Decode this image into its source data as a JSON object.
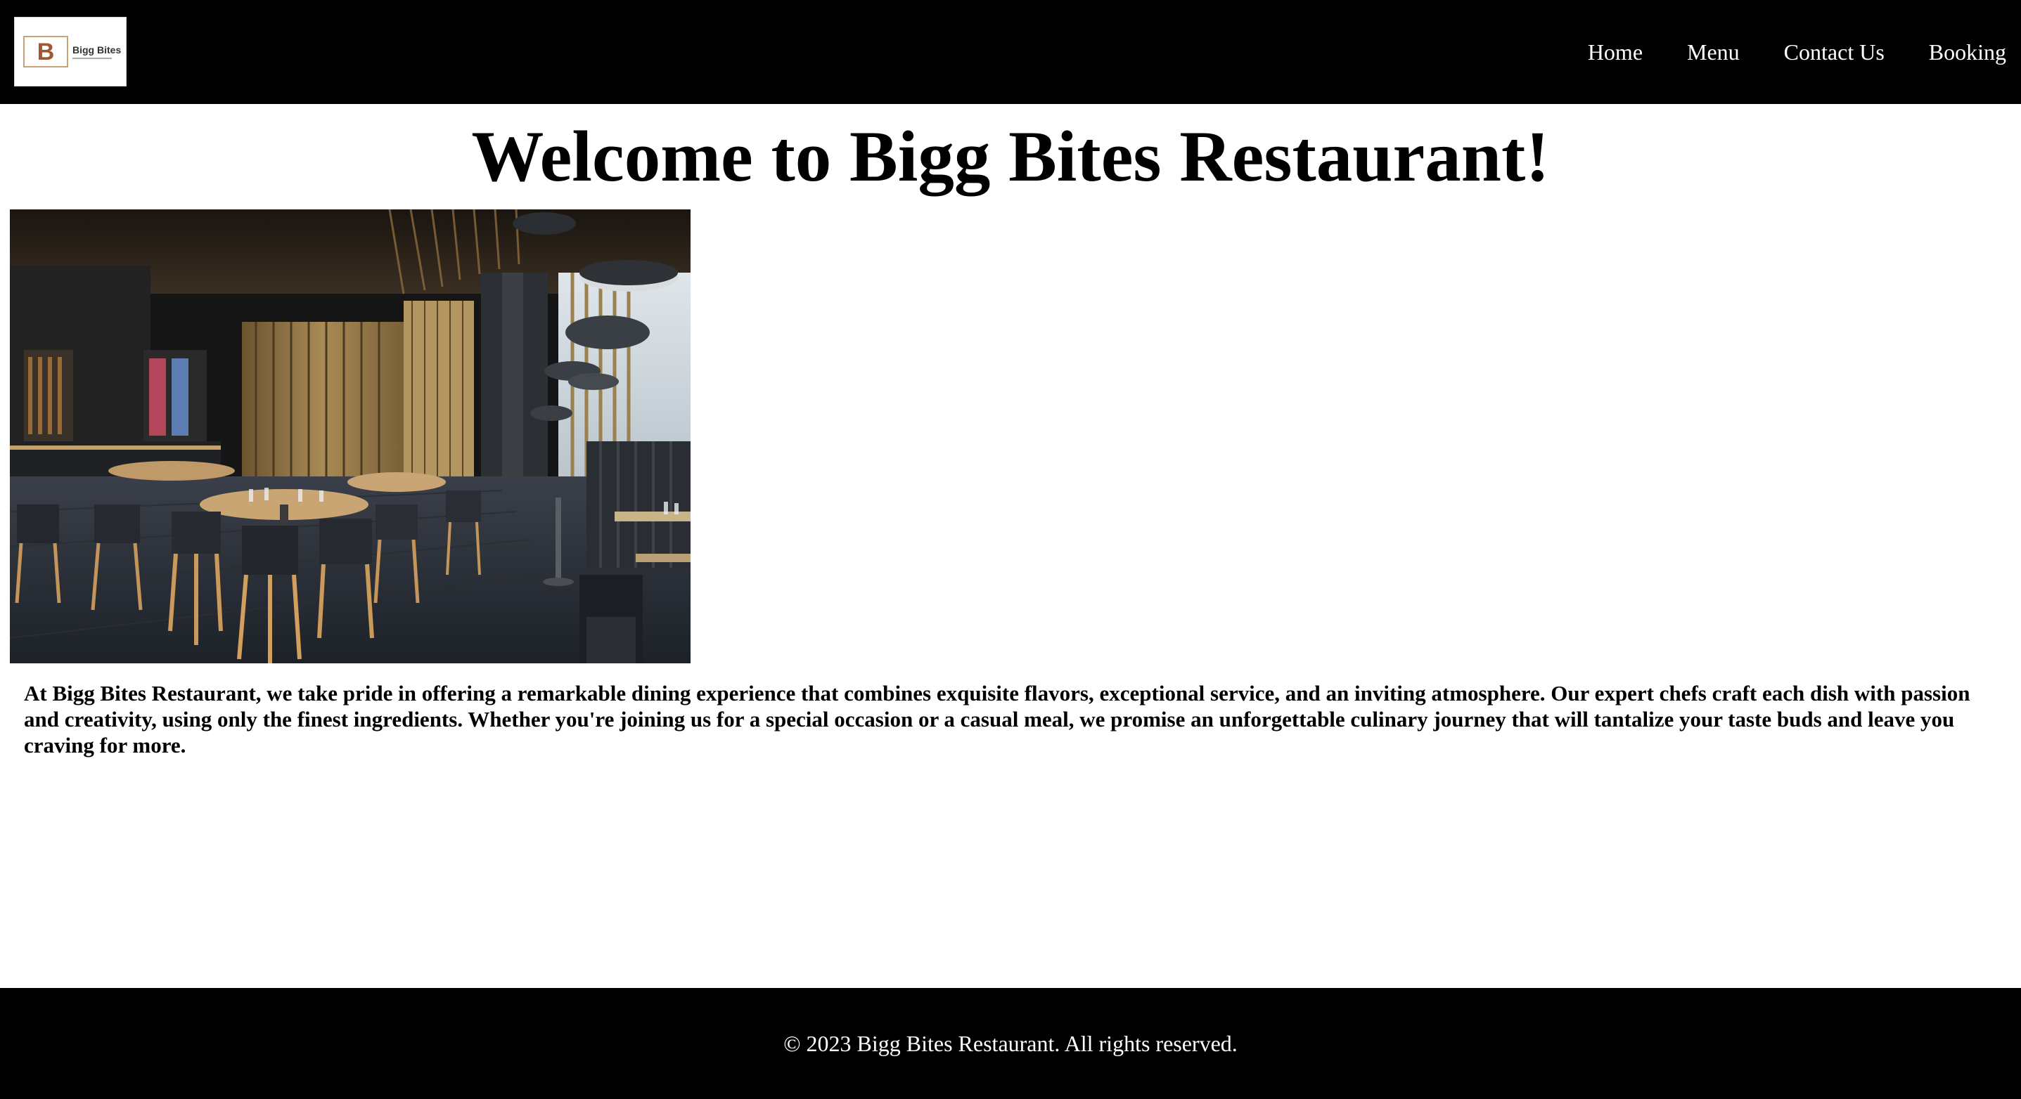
{
  "header": {
    "logo": {
      "letter": "B",
      "name": "Bigg Bites"
    },
    "nav": [
      {
        "label": "Home"
      },
      {
        "label": "Menu"
      },
      {
        "label": "Contact Us"
      },
      {
        "label": "Booking"
      }
    ]
  },
  "main": {
    "title": "Welcome to Bigg Bites Restaurant!",
    "intro": "At Bigg Bites Restaurant, we take pride in offering a remarkable dining experience that combines exquisite flavors, exceptional service, and an inviting atmosphere. Our expert chefs craft each dish with passion and creativity, using only the finest ingredients. Whether you're joining us for a special occasion or a casual meal, we promise an unforgettable culinary journey that will tantalize your taste buds and leave you craving for more."
  },
  "footer": {
    "copyright": "© 2023 Bigg Bites Restaurant. All rights reserved."
  },
  "colors": {
    "header_bg": "#000000",
    "footer_bg": "#000000",
    "nav_text": "#ffffff",
    "body_text": "#000000"
  }
}
